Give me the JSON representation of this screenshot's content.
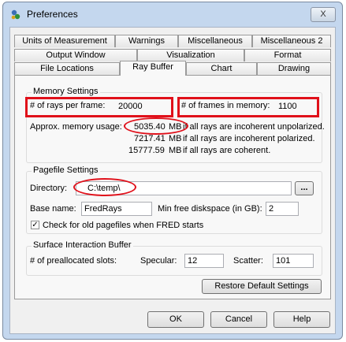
{
  "window": {
    "title": "Preferences",
    "close_symbol": "X"
  },
  "tabs": {
    "row1": [
      "Units of Measurement",
      "Warnings",
      "Miscellaneous",
      "Miscellaneous 2"
    ],
    "row2": [
      "Output Window",
      "Visualization",
      "Format"
    ],
    "row3": [
      "File Locations",
      "Ray Buffer",
      "Chart",
      "Drawing"
    ],
    "active": "Ray Buffer"
  },
  "memory": {
    "group_title": "Memory Settings",
    "rays_per_frame_label": "# of rays per frame:",
    "rays_per_frame_value": "20000",
    "frames_in_memory_label": "# of frames in memory:",
    "frames_in_memory_value": "1100",
    "approx_label": "Approx. memory usage:",
    "usage": [
      {
        "value": "5035.40",
        "unit": "MB",
        "desc": "if all rays are incoherent unpolarized."
      },
      {
        "value": "7217.41",
        "unit": "MB",
        "desc": "if all rays are incoherent polarized."
      },
      {
        "value": "15777.59",
        "unit": "MB",
        "desc": "if all rays are coherent."
      }
    ]
  },
  "pagefile": {
    "group_title": "Pagefile Settings",
    "directory_label": "Directory:",
    "directory_value": "C:\\temp\\",
    "browse_label": "...",
    "base_name_label": "Base name:",
    "base_name_value": "FredRays",
    "min_free_label": "Min free diskspace (in GB):",
    "min_free_value": "2",
    "check_old_label": "Check for old pagefiles when FRED starts",
    "check_old_checked": true
  },
  "surface": {
    "group_title": "Surface Interaction Buffer",
    "prealloc_label": "# of preallocated slots:",
    "specular_label": "Specular:",
    "specular_value": "12",
    "scatter_label": "Scatter:",
    "scatter_value": "101"
  },
  "buttons": {
    "restore_default": "Restore Default Settings",
    "ok": "OK",
    "cancel": "Cancel",
    "help": "Help"
  },
  "annotation_color": "#e0101a"
}
